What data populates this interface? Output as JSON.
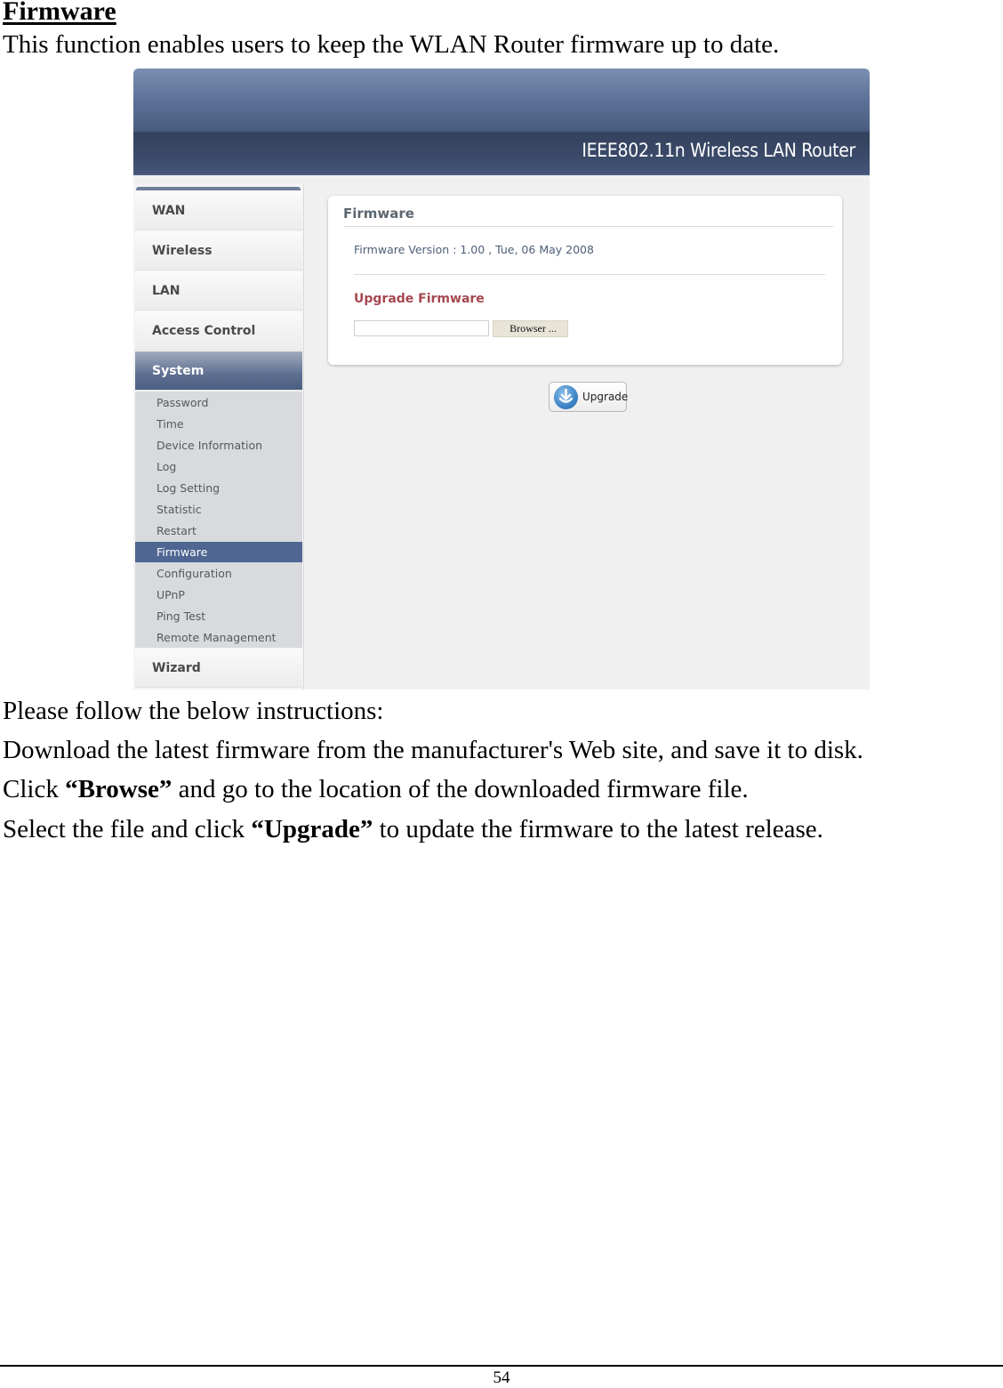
{
  "document": {
    "section_title": "Firmware",
    "intro": "This function enables users to keep the WLAN Router firmware up to date.",
    "instructions_heading": "Please follow the below instructions:",
    "steps": [
      {
        "before": "Download the latest firmware from the manufacturer's Web site, and save it to disk.",
        "bold": "",
        "after": ""
      },
      {
        "before": "Click ",
        "bold": "“Browse”",
        "after": " and go to the location of the downloaded firmware file."
      },
      {
        "before": "Select the file and click ",
        "bold": "“Upgrade”",
        "after": " to update the firmware to the latest release."
      }
    ],
    "page_number": "54"
  },
  "router_ui": {
    "banner_title": "IEEE802.11n  Wireless LAN Router",
    "sidebar": {
      "main_items": [
        {
          "label": "WAN",
          "active": false
        },
        {
          "label": "Wireless",
          "active": false
        },
        {
          "label": "LAN",
          "active": false
        },
        {
          "label": "Access Control",
          "active": false
        },
        {
          "label": "System",
          "active": true
        }
      ],
      "sub_items": [
        {
          "label": "Password",
          "active": false
        },
        {
          "label": "Time",
          "active": false
        },
        {
          "label": "Device Information",
          "active": false
        },
        {
          "label": "Log",
          "active": false
        },
        {
          "label": "Log Setting",
          "active": false
        },
        {
          "label": "Statistic",
          "active": false
        },
        {
          "label": "Restart",
          "active": false
        },
        {
          "label": "Firmware",
          "active": true
        },
        {
          "label": "Configuration",
          "active": false
        },
        {
          "label": "UPnP",
          "active": false
        },
        {
          "label": "Ping Test",
          "active": false
        },
        {
          "label": "Remote Management",
          "active": false
        }
      ],
      "footer_item": {
        "label": "Wizard"
      }
    },
    "panel": {
      "title": "Firmware",
      "version_text": "Firmware Version : 1.00 , Tue, 06 May 2008",
      "upgrade_heading": "Upgrade Firmware",
      "file_input_value": "",
      "browse_label": "Browser ...",
      "upgrade_label": "Upgrade",
      "upgrade_icon": "download-arrow-icon"
    },
    "colors": {
      "banner": "#4a5d80",
      "active_sub": "#4f6692",
      "upgrade_heading": "#a5484f",
      "version_text": "#4d5e78"
    }
  }
}
